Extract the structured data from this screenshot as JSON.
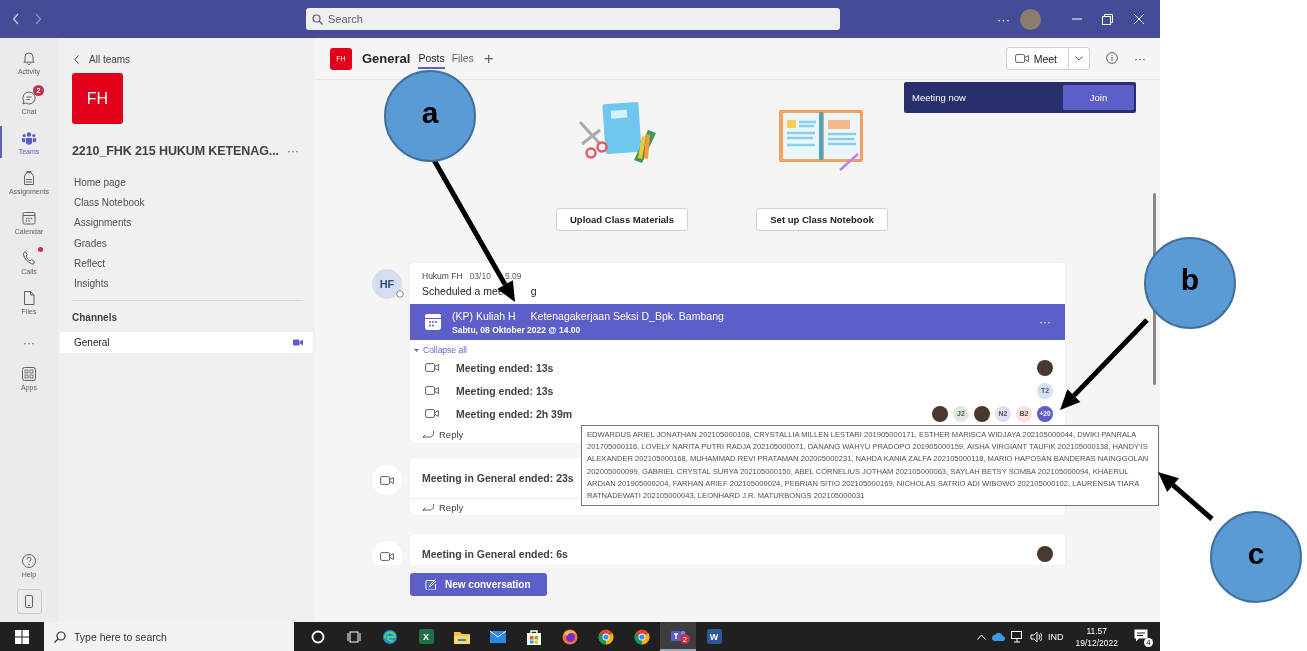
{
  "title_bar": {
    "search_placeholder": "Search",
    "more": "···"
  },
  "app_rail": {
    "items": [
      {
        "label": "Activity",
        "kind": "bell",
        "selected": false,
        "notification_dot": false
      },
      {
        "label": "Chat",
        "kind": "chat",
        "selected": false,
        "notification_dot": false,
        "badge": "2"
      },
      {
        "label": "Teams",
        "kind": "teams",
        "selected": true,
        "notification_dot": false
      },
      {
        "label": "Assignments",
        "kind": "backpack",
        "selected": false,
        "notification_dot": false
      },
      {
        "label": "Calendar",
        "kind": "calendar",
        "selected": false,
        "notification_dot": false
      },
      {
        "label": "Calls",
        "kind": "phone",
        "selected": false,
        "notification_dot": true
      },
      {
        "label": "Files",
        "kind": "file",
        "selected": false,
        "notification_dot": false
      }
    ],
    "more": "···",
    "apps": "Apps",
    "help": "Help"
  },
  "team_panel": {
    "back_label": "All teams",
    "avatar_text": "FH",
    "team_name": "2210_FHK 215 HUKUM KETENAG...",
    "more": "···",
    "nav_items": [
      "Home page",
      "Class Notebook",
      "Assignments",
      "Grades",
      "Reflect",
      "Insights"
    ],
    "channels_heading": "Channels",
    "channels": [
      {
        "name": "General",
        "selected": true,
        "meeting_active": true
      }
    ]
  },
  "channel_header": {
    "avatar_text": "FH",
    "title": "General",
    "tabs": [
      {
        "label": "Posts",
        "selected": true
      },
      {
        "label": "Files",
        "selected": false
      }
    ],
    "add": "+",
    "meet_button": "Meet",
    "more": "···"
  },
  "meeting_banner": {
    "text": "Meeting now",
    "join": "Join"
  },
  "welcome_actions": [
    {
      "label": "Upload Class Materials",
      "kind": "materials"
    },
    {
      "label": "Set up Class Notebook",
      "kind": "notebook"
    }
  ],
  "posts": [
    {
      "kind": "meeting_series",
      "author_initials": "HF",
      "author": "Hukum FH",
      "time_parts": [
        "03/10",
        "5.09"
      ],
      "message_parts": [
        "Scheduled a mee",
        "g"
      ],
      "meeting": {
        "title_parts": [
          "(KP) Kuliah H",
          "Ketenagakerjaan Seksi D_Bpk. Bambang"
        ],
        "subtitle": "Sabtu, 08 Oktober 2022 @ 14.00",
        "more": "···"
      },
      "collapse_label": "Collapse all",
      "expanded": true,
      "events": [
        {
          "text": "Meeting ended: 13s",
          "participants": [
            {
              "kind": "photo"
            }
          ]
        },
        {
          "text": "Meeting ended: 13s",
          "participants": [
            {
              "kind": "initials",
              "text": "T2",
              "color": "#d3e1f3"
            }
          ]
        },
        {
          "text": "Meeting ended: 2h 39m",
          "participants": [
            {
              "kind": "photo"
            },
            {
              "kind": "initials",
              "text": "J2",
              "color": "#dfeadb"
            },
            {
              "kind": "photo"
            },
            {
              "kind": "initials",
              "text": "N2",
              "color": "#e2e0f7"
            },
            {
              "kind": "initials",
              "text": "B2",
              "color": "#fae0e0"
            },
            {
              "kind": "overflow",
              "text": "+20"
            }
          ]
        }
      ],
      "reply": "Reply"
    },
    {
      "kind": "meeting_ended",
      "text": "Meeting in General ended: 23s",
      "reply": "Reply"
    },
    {
      "kind": "meeting_ended",
      "text": "Meeting in General ended: 6s",
      "participants": [
        {
          "kind": "photo"
        }
      ]
    }
  ],
  "tooltip": {
    "text": "EDWARDUS ARIEL JONATHAN 202105000108, CRYSTALLIA MILLEN LESTARI 201905000171, ESTHER MARISCA WIDJAYA 202105000044, DWIKI PANRALA 201705000116, LOVELY NARITA PUTRI RADJA 202105000071, DANANG WAHYU PRADOPO 201905000159, AISHA VIRGIANT TAUFIK 202105000138, HANDY'IS ALEXANDER 202105000168, MUHAMMAD REVI PRATAMAN 202005000231, NAHDA KANIA ZALFA 202105000118, MARIO HAPOSAN BANDERAS NAINGGOLAN 202005000099, GABRIEL CRYSTAL SURYA 202105000150, ABEL CORNELIUS JOTHAM 202105000063, SAYLAH BETSY SOMBA 202105000094, KHAERUL ARDIAN 201905000204, FARHAN ARIEF 202105000024, PEBRIAN SITIO 202105000169, NICHOLAS SATRIO ADI WIBOWO 202105000102, LAURENSIA TIARA RATNADEWATI 202105000043, LEONHARD J.R. MATURBONGS 202105000031"
  },
  "new_conversation": "New conversation",
  "taskbar": {
    "search_placeholder": "Type here to search",
    "apps": [
      {
        "kind": "cortana",
        "active": false
      },
      {
        "kind": "taskview",
        "active": false
      },
      {
        "kind": "edge",
        "active": false
      },
      {
        "kind": "excel",
        "letter": "X",
        "active": false
      },
      {
        "kind": "explorer",
        "active": false
      },
      {
        "kind": "mail",
        "active": false
      },
      {
        "kind": "store",
        "active": false
      },
      {
        "kind": "firefox",
        "active": false
      },
      {
        "kind": "chrome",
        "active": false
      },
      {
        "kind": "chrome",
        "active": false
      },
      {
        "kind": "teams",
        "badge": "2",
        "active": true
      },
      {
        "kind": "word",
        "letter": "W",
        "active": false
      }
    ],
    "language": "IND",
    "time": "11.57",
    "date": "19/12/2022",
    "notification_count": "4"
  },
  "annotations": [
    {
      "label": "a"
    },
    {
      "label": "b"
    },
    {
      "label": "c"
    }
  ]
}
